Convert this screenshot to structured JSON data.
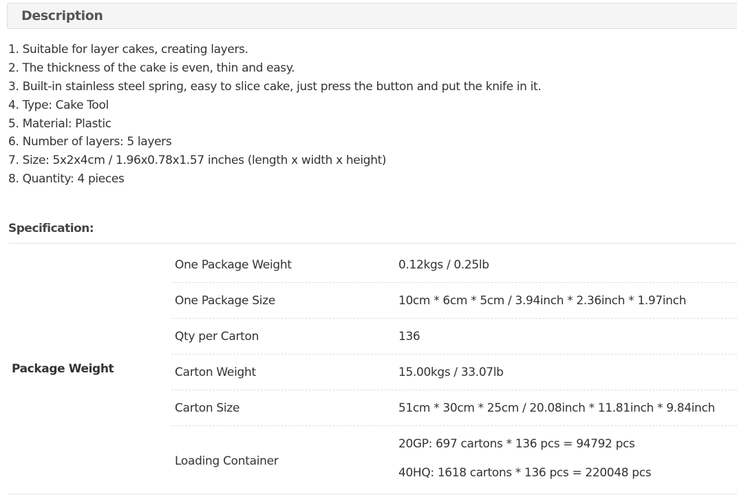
{
  "description": {
    "title": "Description",
    "items": [
      "1. Suitable for layer cakes, creating layers.",
      "2. The thickness of the cake is even, thin and easy.",
      "3. Built-in stainless steel spring, easy to slice cake, just press the button and put the knife in it.",
      "4. Type: Cake Tool",
      "5. Material: Plastic",
      "6. Number of layers: 5 layers",
      "7. Size: 5x2x4cm / 1.96x0.78x1.57 inches (length x width x height)",
      "8. Quantity: 4 pieces"
    ]
  },
  "specification": {
    "title": "Specification:",
    "group_label": "Package Weight",
    "rows": [
      {
        "name": "One Package Weight",
        "value": "0.12kgs / 0.25lb"
      },
      {
        "name": "One Package Size",
        "value": "10cm * 6cm * 5cm / 3.94inch * 2.36inch * 1.97inch"
      },
      {
        "name": "Qty per Carton",
        "value": "136"
      },
      {
        "name": "Carton Weight",
        "value": "15.00kgs / 33.07lb"
      },
      {
        "name": "Carton Size",
        "value": "51cm * 30cm * 25cm / 20.08inch * 11.81inch * 9.84inch"
      },
      {
        "name": "Loading Container",
        "values": [
          "20GP: 697 cartons * 136 pcs = 94792 pcs",
          "40HQ: 1618 cartons * 136 pcs = 220048 pcs"
        ]
      }
    ]
  }
}
